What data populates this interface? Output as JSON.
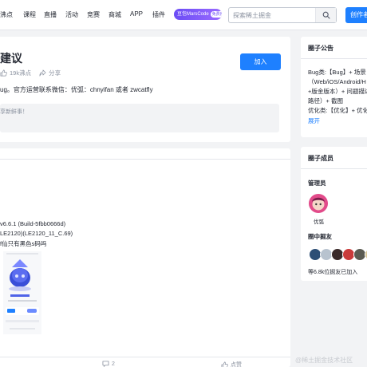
{
  "nav": {
    "items": [
      "沸点",
      "课程",
      "直播",
      "活动",
      "竞赛",
      "商城",
      "APP",
      "插件"
    ],
    "marscode": "豆包MarsCode",
    "marscode_badge": "免费用",
    "search_placeholder": "探索稀土掘金",
    "create_label": "创作者"
  },
  "circle": {
    "title": "建议",
    "pins_count": "19k沸点",
    "share_label": "分享",
    "join_label": "加入",
    "description": "ug。官方运营联系微信：优弧：chnyifan 或者 zwcatfly",
    "composer_placeholder": "享新鲜事！"
  },
  "post": {
    "lines": [
      "v6.6.1 (Build-5fbb0666d)",
      "LE2120)(LE2120_11_C.69)",
      "f仙只有黑色s码吗"
    ],
    "comment_count": "2",
    "like_label": "点赞"
  },
  "announcement": {
    "title": "圈子公告",
    "lines": [
      "Bug类:【Bug】+ 场景",
      "（Web/iOS/Android/H",
      "+版金版本）+ 问题描述",
      "路径）+ 截图",
      "优化类:【优化】+ 优化"
    ],
    "expand_label": "展开"
  },
  "members": {
    "title": "圈子成员",
    "admin_label": "管理员",
    "admin_name": "优弧",
    "friends_label": "圈中掘友",
    "friends_summary": "等6.8k位掘友已加入"
  },
  "watermark": "@稀土掘金技术社区",
  "colors": {
    "accent": "#1e80ff",
    "bg": "#f2f3f5",
    "muted": "#8a919f"
  }
}
